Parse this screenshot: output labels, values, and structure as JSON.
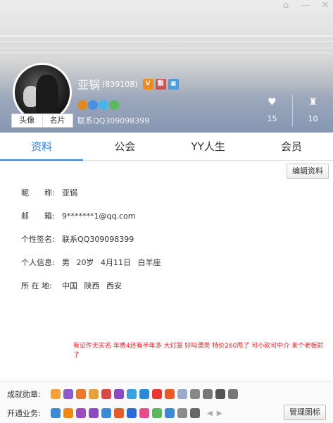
{
  "header": {
    "name": "亚锅",
    "uid": "(839108)",
    "badges": [
      "V",
      "靓",
      "■"
    ],
    "signature": "联系QQ309098399",
    "avatar_tabs": [
      "头像",
      "名片"
    ],
    "stats": [
      {
        "icon": "heart-icon",
        "glyph": "♥",
        "value": "15"
      },
      {
        "icon": "fan-icon",
        "glyph": "♜",
        "value": "10"
      }
    ],
    "medal_colors": [
      "#e08a1e",
      "#4a90e2",
      "#46b6e8",
      "#5cb85c"
    ]
  },
  "tabs": [
    "资料",
    "公会",
    "YY人生",
    "会员"
  ],
  "edit_label": "编辑资料",
  "info": {
    "nickname_label": "昵　　称:",
    "nickname": "亚锅",
    "email_label": "邮　　箱:",
    "email": "9*******1@qq.com",
    "sign_label": "个性签名:",
    "sign": "联系QQ309098399",
    "personal_label": "个人信息:",
    "personal": "男 20岁 4月11日 白羊座",
    "location_label": "所 在 地:",
    "location": "中国 陕西 西安"
  },
  "note": "有证件无实名 年费4还有半年多 大灯笼 好吗漂亮 特价260甩了 可小砍可中介 来个老板射了",
  "bottom": {
    "achievements_label": "成就勋章:",
    "services_label": "开通业务:",
    "manage_label": "管理图标",
    "achievement_colors": [
      "#f3a23b",
      "#8a5cc7",
      "#e6792a",
      "#e8a13a",
      "#d84a4a",
      "#8a4ac0",
      "#3aa0e0",
      "#2a8ad8",
      "#e33",
      "#e85a2a",
      "#9ac",
      "#888",
      "#777",
      "#555",
      "#777"
    ],
    "service_colors": [
      "#3a8ad8",
      "#f08a12",
      "#a04ac0",
      "#8a4ac0",
      "#3a8ad8",
      "#e85a2a",
      "#2a6ad8",
      "#e84a8a",
      "#5cb85c",
      "#3a8ad8",
      "#8a8a8a",
      "#666"
    ]
  }
}
